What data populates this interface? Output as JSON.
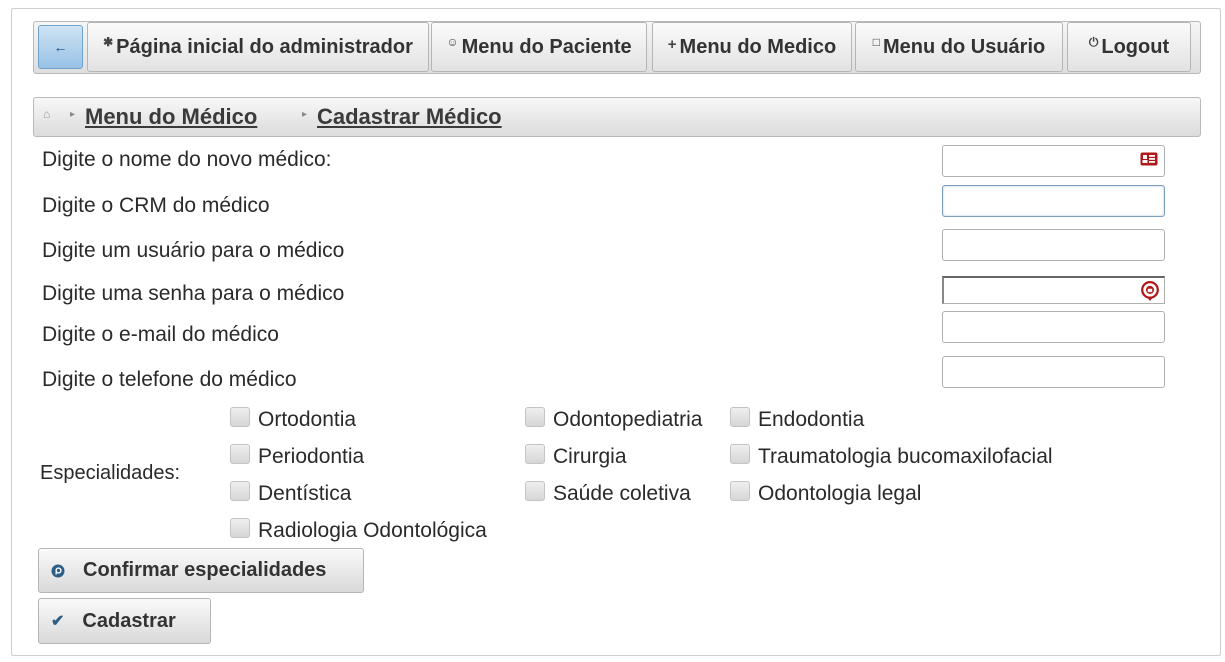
{
  "nav": {
    "back_icon": "arrow-left-icon",
    "items": [
      {
        "label": "Página inicial do administrador",
        "icon": "gear-icon"
      },
      {
        "label": "Menu do Paciente",
        "icon": "person-icon"
      },
      {
        "label": "Menu do Medico",
        "icon": "plus-icon"
      },
      {
        "label": "Menu do Usuário",
        "icon": "clipboard-icon"
      },
      {
        "label": "Logout",
        "icon": "power-icon"
      }
    ]
  },
  "breadcrumb": {
    "home_icon": "home-icon",
    "items": [
      "Menu do Médico",
      "Cadastrar Médico"
    ]
  },
  "form": {
    "fields": [
      {
        "label": "Digite o nome do novo médico:",
        "value": "",
        "icon": "id-card-icon"
      },
      {
        "label": "Digite o CRM do médico",
        "value": ""
      },
      {
        "label": "Digite um usuário para o médico",
        "value": ""
      },
      {
        "label": "Digite uma senha para o médico",
        "value": "",
        "icon": "password-key-icon"
      },
      {
        "label": "Digite o e-mail do médico",
        "value": ""
      },
      {
        "label": "Digite o telefone do médico",
        "value": ""
      }
    ],
    "specialties_label": "Especialidades:",
    "specialties": [
      {
        "label": "Ortodontia",
        "checked": false
      },
      {
        "label": "Odontopediatria",
        "checked": false
      },
      {
        "label": "Endodontia",
        "checked": false
      },
      {
        "label": "Periodontia",
        "checked": false
      },
      {
        "label": "Cirurgia",
        "checked": false
      },
      {
        "label": "Traumatologia bucomaxilofacial",
        "checked": false
      },
      {
        "label": "Dentística",
        "checked": false
      },
      {
        "label": "Saúde coletiva",
        "checked": false
      },
      {
        "label": "Odontologia legal",
        "checked": false
      },
      {
        "label": "Radiologia Odontológica",
        "checked": false
      }
    ],
    "confirm_button": "Confirmar especialidades",
    "submit_button": "Cadastrar"
  },
  "colors": {
    "accent_blue": "#98c2e6",
    "icon_red": "#b01818"
  }
}
